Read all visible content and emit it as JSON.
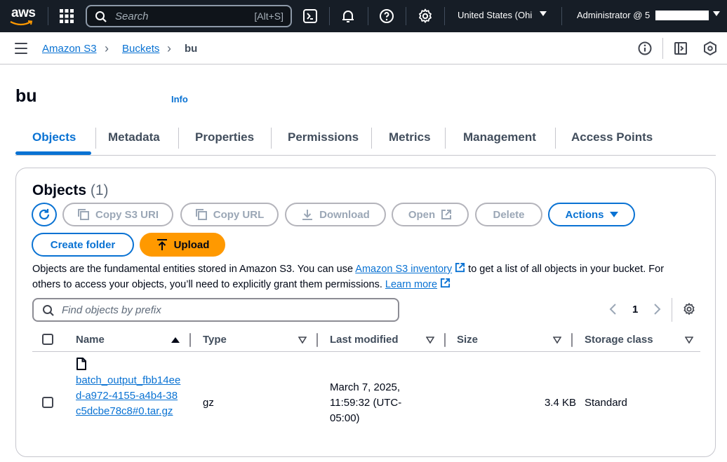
{
  "topnav": {
    "logo_text": "aws",
    "search_placeholder": "Search",
    "search_shortcut": "[Alt+S]",
    "region": "United States (Ohi",
    "user": "Administrator @ 5",
    "icons": [
      "grid-icon",
      "search-icon",
      "cloudshell-icon",
      "bell-icon",
      "help-icon",
      "gear-icon"
    ]
  },
  "breadcrumb": {
    "items": [
      "Amazon S3",
      "Buckets",
      "bu"
    ]
  },
  "page": {
    "title": "bu",
    "info": "Info"
  },
  "tabs": [
    "Objects",
    "Metadata",
    "Properties",
    "Permissions",
    "Metrics",
    "Management",
    "Access Points"
  ],
  "objects": {
    "title": "Objects",
    "count": "(1)",
    "buttons": {
      "copy_uri": "Copy S3 URI",
      "copy_url": "Copy URL",
      "download": "Download",
      "open": "Open",
      "delete": "Delete",
      "actions": "Actions",
      "create_folder": "Create folder",
      "upload": "Upload"
    },
    "description": {
      "part1": "Objects are the fundamental entities stored in Amazon S3. You can use ",
      "link1": "Amazon S3 inventory",
      "part2": " to get a list of all objects in your bucket. For others to access your objects, you’ll need to explicitly grant them permissions. ",
      "link2": "Learn more"
    },
    "filter_placeholder": "Find objects by prefix",
    "page": "1",
    "columns": [
      "Name",
      "Type",
      "Last modified",
      "Size",
      "Storage class"
    ],
    "rows": [
      {
        "name": "batch_output_fbb14eed-a972-4155-a4b4-38c5dcbe78c8#0.tar.gz",
        "type": "gz",
        "last_modified": "March 7, 2025, 11:59:32 (UTC-05:00)",
        "size": "3.4 KB",
        "storage_class": "Standard"
      }
    ]
  },
  "colors": {
    "nav_bg": "#161d26",
    "link": "#0972d3",
    "upload": "#ff9900"
  }
}
